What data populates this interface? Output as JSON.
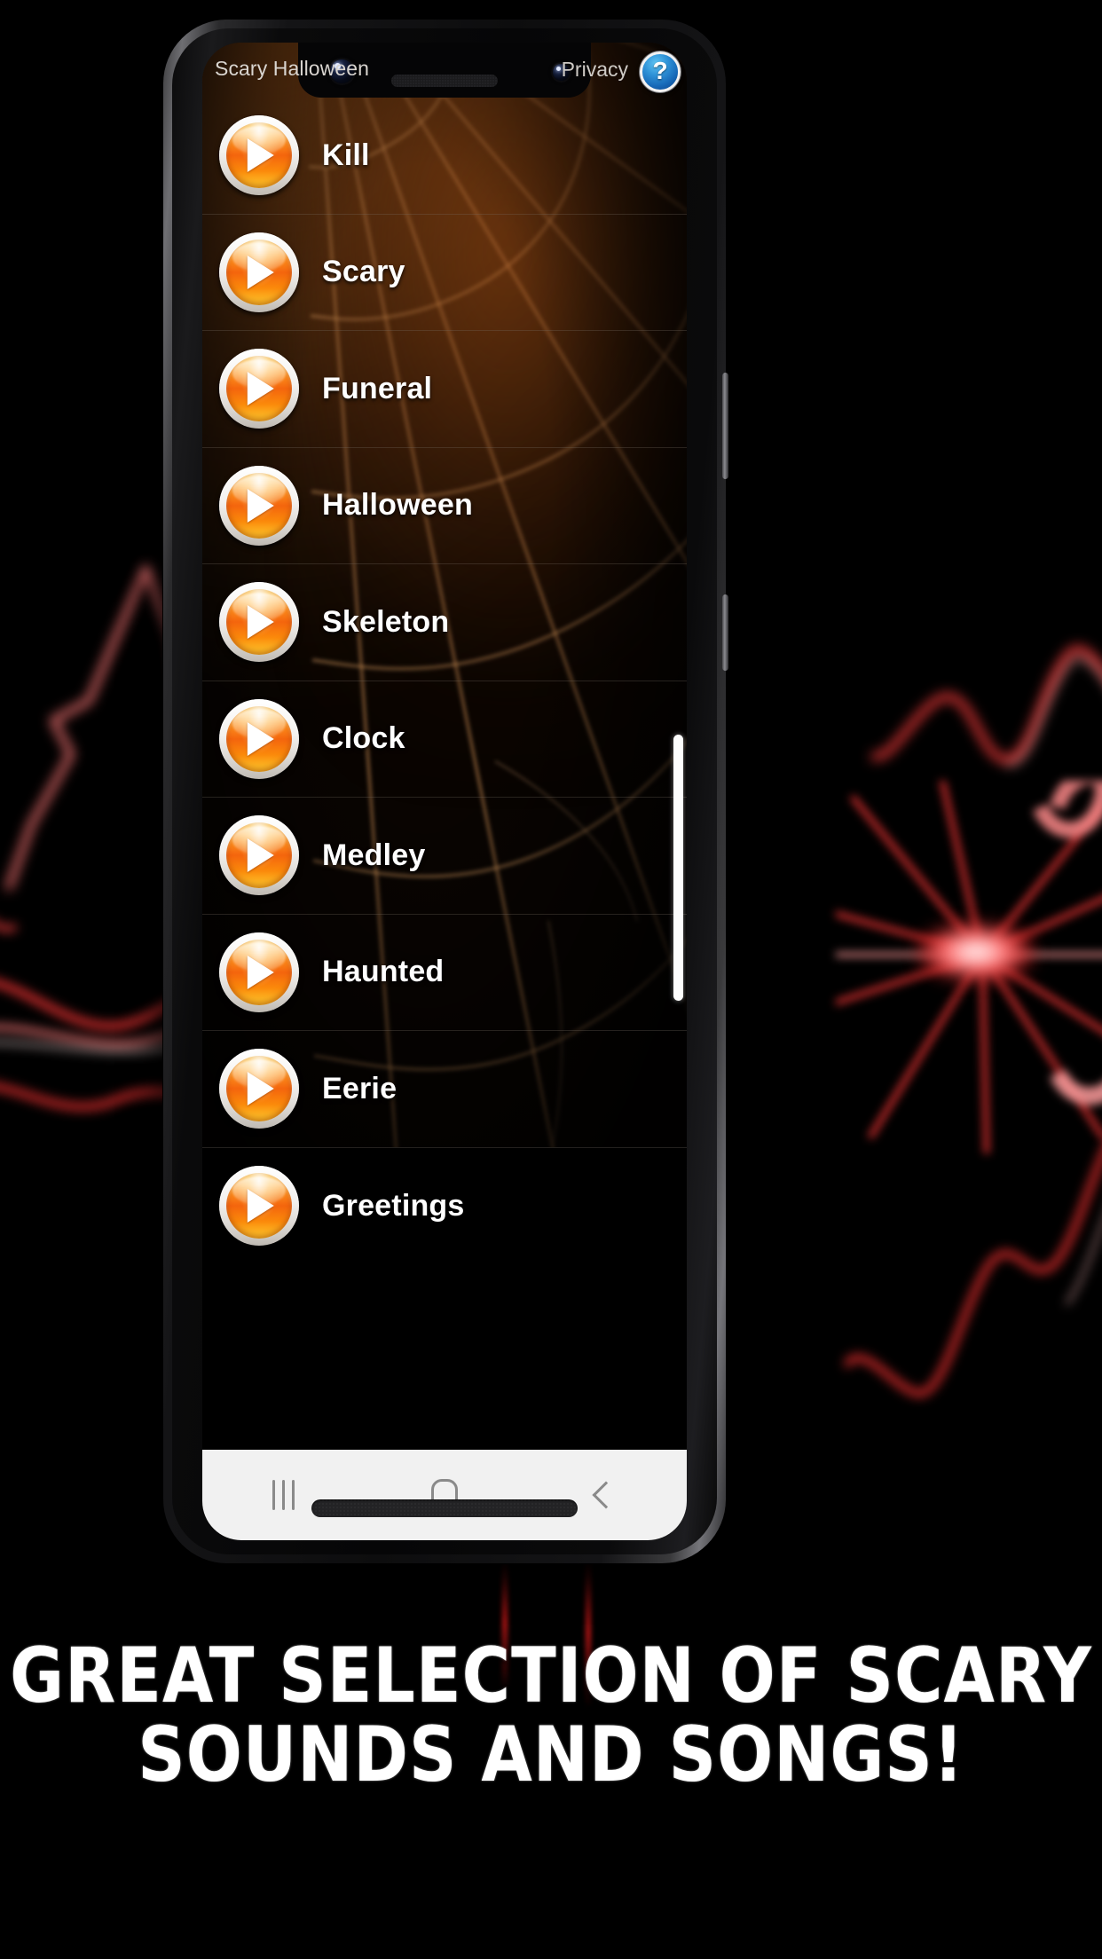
{
  "app": {
    "title": "Scary Halloween",
    "privacy_label": "Privacy",
    "help_icon_glyph": "?"
  },
  "sounds": [
    {
      "label": "Kill"
    },
    {
      "label": "Scary"
    },
    {
      "label": "Funeral"
    },
    {
      "label": "Halloween"
    },
    {
      "label": "Skeleton"
    },
    {
      "label": "Clock"
    },
    {
      "label": "Medley"
    },
    {
      "label": "Haunted"
    },
    {
      "label": "Eerie"
    },
    {
      "label": "Greetings"
    }
  ],
  "navbar": {
    "recents_label": "Recents",
    "home_label": "Home",
    "back_label": "Back"
  },
  "promo": {
    "line1": "Great selection of scary",
    "line2": "sounds and songs!"
  },
  "colors": {
    "accent_orange": "#f4650d",
    "help_blue": "#1669b8",
    "promo_text": "#ffffff",
    "background": "#000000",
    "glow_red": "#d61717",
    "web_brown": "#6b3a12"
  }
}
